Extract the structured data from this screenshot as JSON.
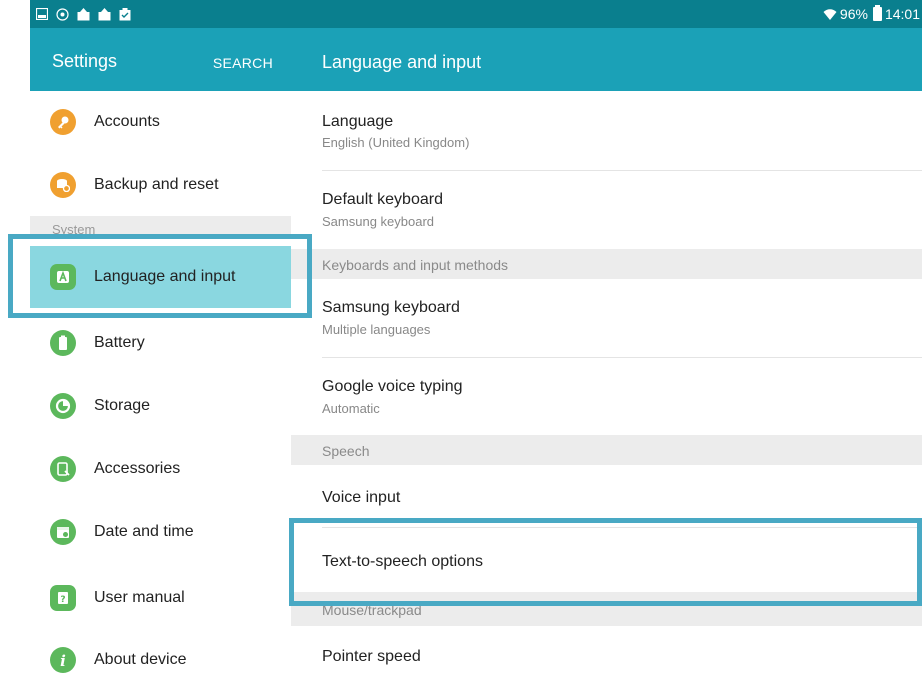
{
  "status_bar": {
    "notification_icons": [
      "gallery-icon",
      "sync-icon",
      "upload-icon",
      "upload-icon",
      "clipboard-icon"
    ],
    "battery": "96%",
    "time": "14:01"
  },
  "left_pane": {
    "title": "Settings",
    "search_label": "SEARCH",
    "section_system": "System",
    "items": [
      {
        "label": "Accounts",
        "icon": "key-icon",
        "color": "#f0a030"
      },
      {
        "label": "Backup and reset",
        "icon": "backup-icon",
        "color": "#f0a030"
      },
      {
        "label": "Language and input",
        "icon": "language-icon",
        "color": "#5cb85c"
      },
      {
        "label": "Battery",
        "icon": "battery-icon",
        "color": "#5cb85c"
      },
      {
        "label": "Storage",
        "icon": "storage-icon",
        "color": "#5cb85c"
      },
      {
        "label": "Accessories",
        "icon": "accessories-icon",
        "color": "#5cb85c"
      },
      {
        "label": "Date and time",
        "icon": "calendar-icon",
        "color": "#5cb85c"
      },
      {
        "label": "User manual",
        "icon": "manual-icon",
        "color": "#5cb85c"
      },
      {
        "label": "About device",
        "icon": "info-icon",
        "color": "#5cb85c"
      }
    ]
  },
  "right_pane": {
    "title": "Language and input",
    "language": {
      "title": "Language",
      "subtitle": "English (United Kingdom)"
    },
    "default_keyboard": {
      "title": "Default keyboard",
      "subtitle": "Samsung keyboard"
    },
    "section_keyboards": "Keyboards and input methods",
    "samsung_keyboard": {
      "title": "Samsung keyboard",
      "subtitle": "Multiple languages"
    },
    "google_voice": {
      "title": "Google voice typing",
      "subtitle": "Automatic"
    },
    "section_speech": "Speech",
    "voice_input": {
      "title": "Voice input"
    },
    "tts": {
      "title": "Text-to-speech options"
    },
    "section_mouse": "Mouse/trackpad",
    "pointer_speed": {
      "title": "Pointer speed"
    }
  },
  "colors": {
    "header": "#1ba1b7",
    "status_bar": "#0a7f8e",
    "selected": "#8ad7e0",
    "highlight_box": "#49a9c4",
    "orange_icon": "#f0a030",
    "green_icon": "#5cb85c"
  }
}
